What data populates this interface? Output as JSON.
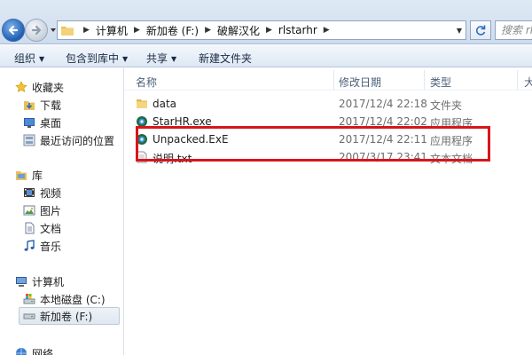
{
  "address": {
    "breadcrumbs": [
      "计算机",
      "新加卷 (F:)",
      "破解汉化",
      "rlstarhr"
    ],
    "search_placeholder": "搜索 rlsta"
  },
  "toolbar": {
    "organize": "组织",
    "include_in_library": "包含到库中",
    "share": "共享",
    "new_folder": "新建文件夹"
  },
  "navigation": {
    "favorites": {
      "label": "收藏夹",
      "items": [
        "下载",
        "桌面",
        "最近访问的位置"
      ]
    },
    "libraries": {
      "label": "库",
      "items": [
        "视频",
        "图片",
        "文档",
        "音乐"
      ]
    },
    "computer": {
      "label": "计算机",
      "items": [
        "本地磁盘 (C:)",
        "新加卷 (F:)"
      ]
    },
    "network": {
      "label": "网络"
    }
  },
  "columns": {
    "name": "名称",
    "modified": "修改日期",
    "type": "类型",
    "size": "大"
  },
  "files": [
    {
      "name": "data",
      "modified": "2017/12/4 22:18",
      "type": "文件夹",
      "icon": "folder-icon"
    },
    {
      "name": "StarHR.exe",
      "modified": "2017/12/4 22:02",
      "type": "应用程序",
      "icon": "exe-icon"
    },
    {
      "name": "Unpacked.ExE",
      "modified": "2017/12/4 22:11",
      "type": "应用程序",
      "icon": "exe-icon"
    },
    {
      "name": "说明.txt",
      "modified": "2007/3/17 23:41",
      "type": "文本文档",
      "icon": "text-file-icon"
    }
  ],
  "colors": {
    "highlight_box": "#d8151c",
    "selected_nav": "#dfe7f0"
  }
}
